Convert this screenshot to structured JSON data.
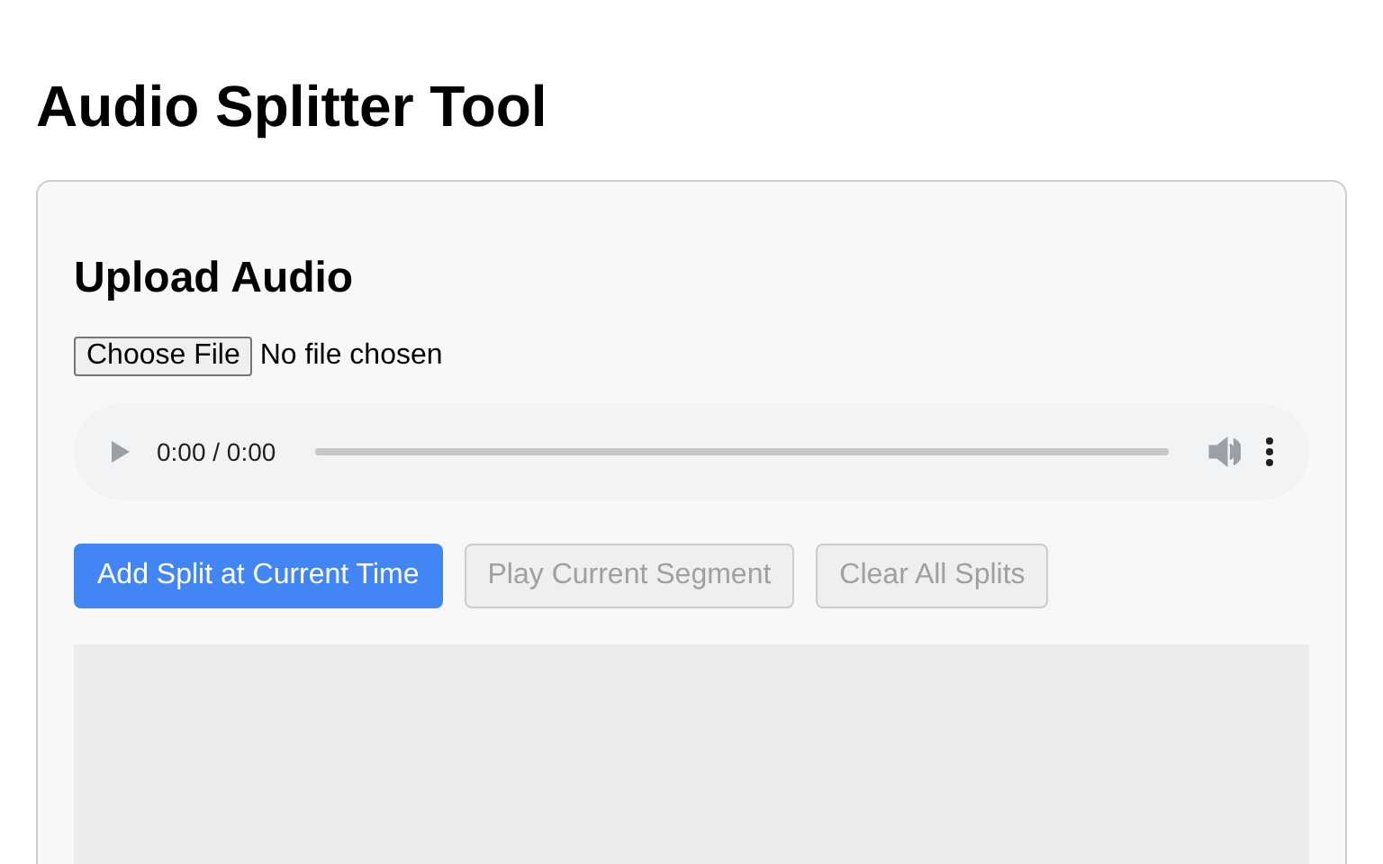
{
  "title": "Audio Splitter Tool",
  "upload": {
    "heading": "Upload Audio",
    "file_button": "Choose File",
    "file_status": "No file chosen"
  },
  "player": {
    "time": "0:00 / 0:00",
    "disabled": true
  },
  "buttons": [
    {
      "label": "Add Split at Current Time",
      "disabled": false
    },
    {
      "label": "Play Current Segment",
      "disabled": true
    },
    {
      "label": "Clear All Splits",
      "disabled": true
    }
  ],
  "waveform": {
    "kind": "empty"
  }
}
